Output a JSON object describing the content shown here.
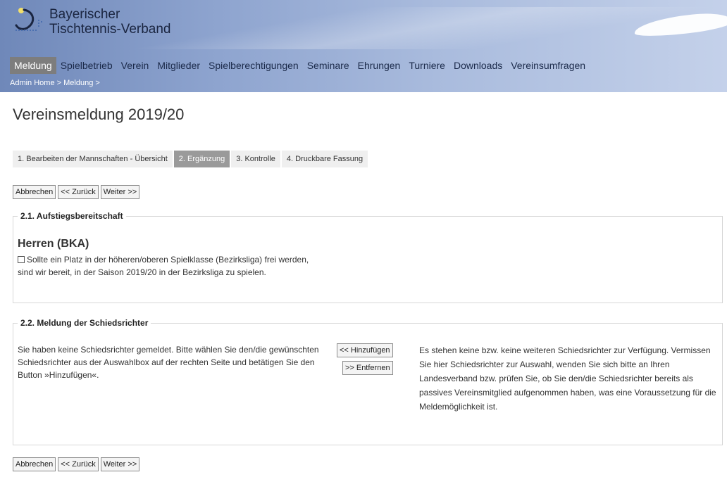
{
  "brand": {
    "line1": "Bayerischer",
    "line2": "Tischtennis-Verband"
  },
  "nav": {
    "items": [
      {
        "label": "Meldung",
        "active": true
      },
      {
        "label": "Spielbetrieb"
      },
      {
        "label": "Verein"
      },
      {
        "label": "Mitglieder"
      },
      {
        "label": "Spielberechtigungen"
      },
      {
        "label": "Seminare"
      },
      {
        "label": "Ehrungen"
      },
      {
        "label": "Turniere"
      },
      {
        "label": "Downloads"
      },
      {
        "label": "Vereinsumfragen"
      }
    ]
  },
  "breadcrumb": "Admin Home > Meldung >",
  "page_title": "Vereinsmeldung 2019/20",
  "steps": [
    {
      "label": "1.  Bearbeiten der Mannschaften - Übersicht"
    },
    {
      "label": "2.  Ergänzung",
      "active": true
    },
    {
      "label": "3.  Kontrolle"
    },
    {
      "label": "4.  Druckbare Fassung"
    }
  ],
  "buttons": {
    "cancel": "Abbrechen",
    "back": "<< Zurück",
    "next": "Weiter >>"
  },
  "section1": {
    "legend": "2.1. Aufstiegsbereitschaft",
    "team_title": "Herren (BKA)",
    "checkbox_label": "Sollte ein Platz in der höheren/oberen Spielklasse (Bezirksliga) frei werden,",
    "line2": "sind wir bereit, in der Saison 2019/20 in der Bezirksliga zu spielen."
  },
  "section2": {
    "legend": "2.2. Meldung der Schiedsrichter",
    "left_text": "Sie haben keine Schiedsrichter gemeldet. Bitte wählen Sie den/die gewünschten Schiedsrichter aus der Auswahlbox auf der rechten Seite und betätigen Sie den Button »Hinzufügen«.",
    "add_button": "<< Hinzufügen",
    "remove_button": ">> Entfernen",
    "right_text": "Es stehen keine bzw. keine weiteren Schiedsrichter zur Verfügung. Vermissen Sie hier Schiedsrichter zur Auswahl, wenden Sie sich bitte an Ihren Landesverband bzw. prüfen Sie, ob Sie den/die Schiedsrichter bereits als passives Vereinsmitglied aufgenommen haben, was eine Voraussetzung für die Meldemöglichkeit ist."
  },
  "icons": {
    "logo": "ttball-logo-icon",
    "checkbox": "checkbox-icon"
  },
  "colors": {
    "header": "#8ea4cf",
    "nav_active": "#7d7d7d",
    "step_active": "#9a9a9a"
  }
}
